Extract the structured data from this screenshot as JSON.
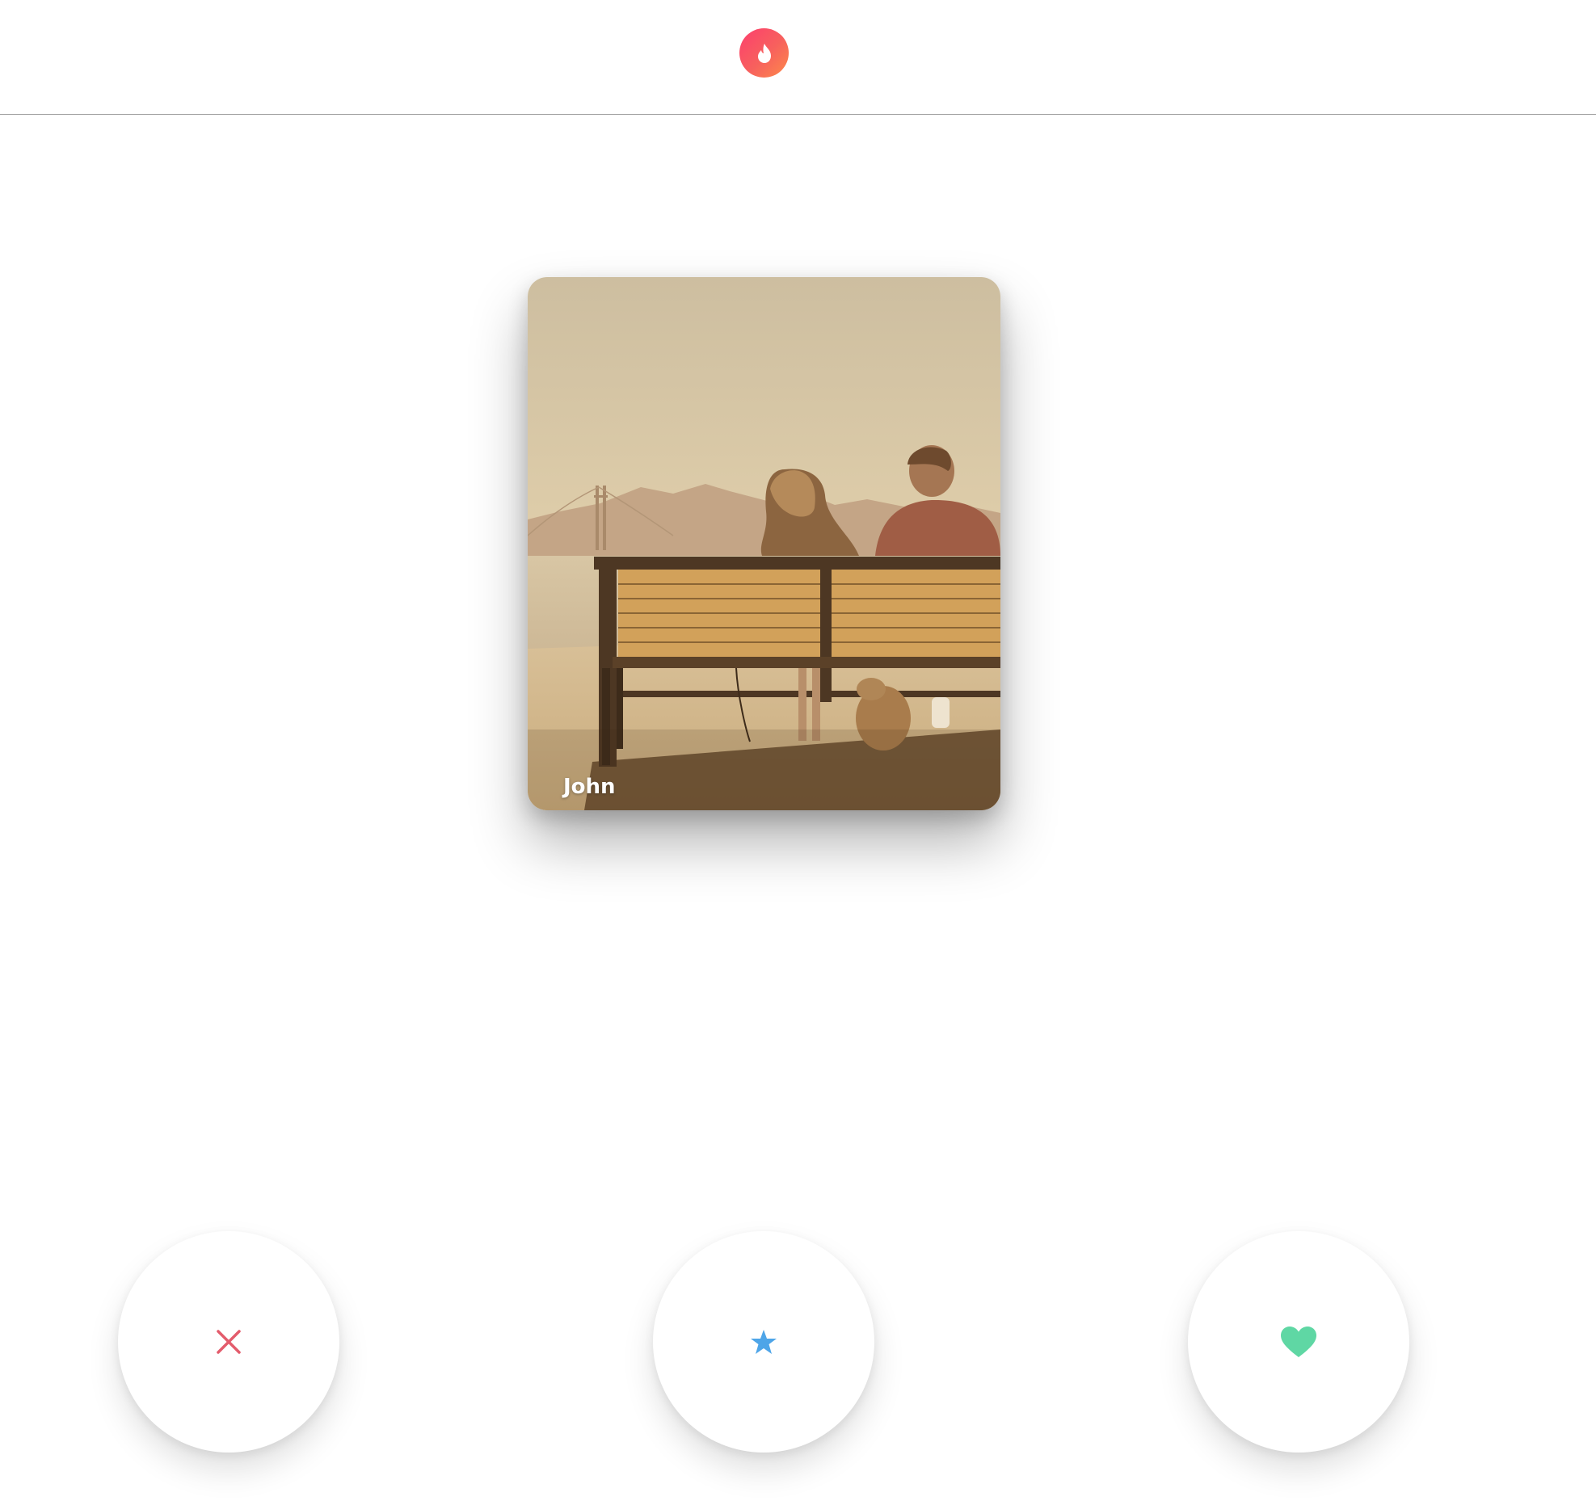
{
  "header": {
    "logo_icon": "flame-icon",
    "logo_gradient": [
      "#fd3e6e",
      "#fd8a4a"
    ]
  },
  "card": {
    "name": "John"
  },
  "actions": [
    {
      "icon": "close-icon",
      "color": "#e35c6c"
    },
    {
      "icon": "star-icon",
      "color": "#4ea5e8"
    },
    {
      "icon": "heart-icon",
      "color": "#5fd7a4"
    }
  ]
}
